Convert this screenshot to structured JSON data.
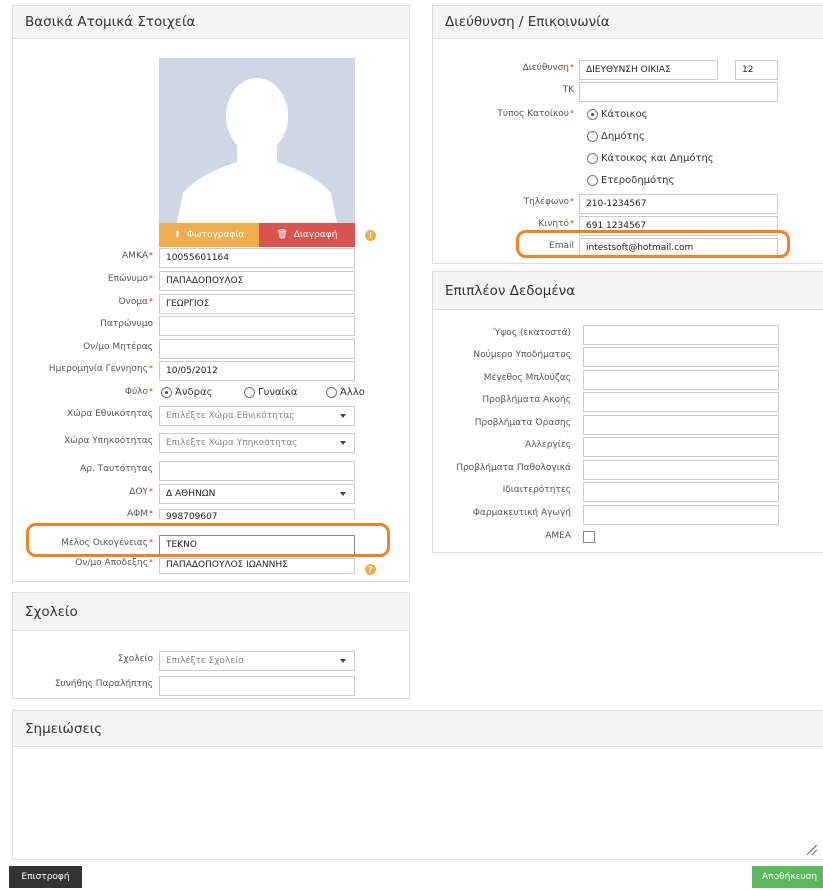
{
  "basic": {
    "title": "Βασικά Ατομικά Στοιχεία",
    "photo_button": "Φωτογραφία",
    "delete_button": "Διαγραφή",
    "fields": [
      {
        "label": "ΑΜΚΑ",
        "value": "10055601164"
      },
      {
        "label": "Επώνυμο",
        "value": "ΠΑΠΑΔΟΠΟΥΛΟΣ"
      },
      {
        "label": "Όνομα",
        "value": "ΓΕΩΡΓΙΟΣ"
      },
      {
        "label": "Πατρώνυμο",
        "value": ""
      },
      {
        "label": "Ον/μο Μητέρας",
        "value": ""
      },
      {
        "label": "Ημερομηνία Γέννησης",
        "value": "10/05/2012"
      },
      {
        "label": "Φύλο"
      },
      {
        "label": "Χώρα Εθνικότητας",
        "placeholder": "Επιλέξτε Χώρα Εθνικότητας"
      },
      {
        "label": "Χώρα Υπηκοότητας",
        "placeholder": "Επιλέξτε Χώρα Υπηκοότητας"
      },
      {
        "label": "Αρ. Ταυτότητας",
        "value": ""
      },
      {
        "label": "ΔΟΥ",
        "value": "Δ ΑΘΗΝΩΝ"
      },
      {
        "label": "ΑΦΜ",
        "value": "998709607"
      },
      {
        "label": "Μέλος Οικογένειας",
        "value": "ΤΕΚΝΟ"
      },
      {
        "label": "Ον/μο Αποδεξης",
        "value": "ΠΑΠΑΔΟΠΟΥΛΟΣ ΙΩΑΝΝΗΣ"
      }
    ],
    "gender": [
      "Άνδρας",
      "Γυναίκα",
      "Άλλο"
    ]
  },
  "address": {
    "title": "Διεύθυνση / Επικοινωνία",
    "address_label": "Διεύθυνση",
    "address_value": "ΔΙΕΥΘΥΝΣΗ ΟΙΚΙΑΣ",
    "number_value": "12",
    "tk_label": "ΤΚ",
    "resident_label": "Τύπος Κατοίκου",
    "resident_options": [
      "Κάτοικος",
      "Δημότης",
      "Κάτοικος και Δημότης",
      "Ετεροδημότης"
    ],
    "phone_label": "Τηλέφωνο",
    "phone_value": "210-1234567",
    "mobile_label": "Κινητό",
    "mobile_value": "691 1234567",
    "email_label": "Email",
    "email_value": "intestsoft@hotmail.com"
  },
  "extra": {
    "title": "Επιπλέον Δεδομένα",
    "labels": [
      "Ύψος (εκατοστά)",
      "Νούμερο Υποδήματος",
      "Μέγεθος Μπλούζας",
      "Προβλήματα Ακοής",
      "Προβλήματα Όρασης",
      "Αλλεργίες",
      "Προβλήματα Παθολογικά",
      "Ιδιαιτερότητες",
      "Φαρμακευτική Αγωγή"
    ],
    "amea_label": "ΑΜΕΑ"
  },
  "school": {
    "title": "Σχολείο",
    "school_label": "Σχολείο",
    "school_placeholder": "Επιλέξτε Σχολείο",
    "pickup_label": "Συνήθης Παραλήπτης"
  },
  "notes": {
    "title": "Σημειώσεις"
  },
  "footer": {
    "back": "Επιστροφή",
    "save": "Αποθήκευση"
  },
  "colors": {
    "accent_orange": "#f58220",
    "photo_btn": "#f0ad4e",
    "delete_btn": "#d9534f",
    "save_btn": "#5cb85c",
    "back_btn": "#333333"
  }
}
